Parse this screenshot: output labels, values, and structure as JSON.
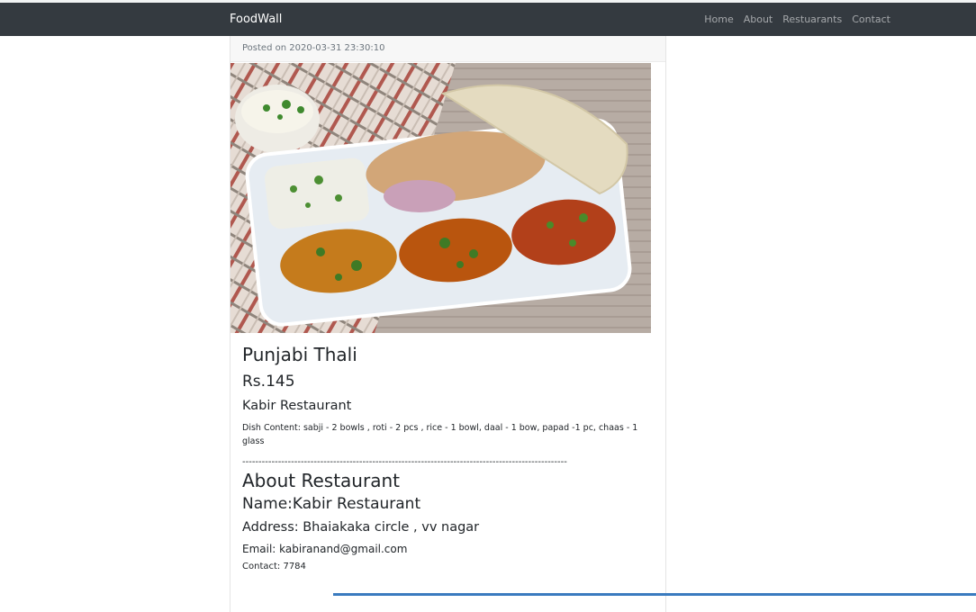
{
  "navbar": {
    "brand": "FoodWall",
    "links": [
      "Home",
      "About",
      "Restuarants",
      "Contact"
    ]
  },
  "post": {
    "posted_on": "Posted on 2020-03-31 23:30:10",
    "image_alt": "Punjabi Thali",
    "title": "Punjabi Thali",
    "price": "Rs.145",
    "restaurant": "Kabir Restaurant",
    "dish_content": "Dish Content: sabji - 2 bowls , roti - 2 pcs , rice - 1 bowl, daal - 1 bow, papad -1 pc, chaas - 1 glass",
    "divider": "----------------------------------------------------------------------------------------------------"
  },
  "about": {
    "heading": "About Restaurant",
    "name": "Name:Kabir Restaurant",
    "address": "Address: Bhaiakaka circle , vv nagar",
    "email": "Email: kabiranand@gmail.com",
    "contact": "Contact: 7784"
  }
}
